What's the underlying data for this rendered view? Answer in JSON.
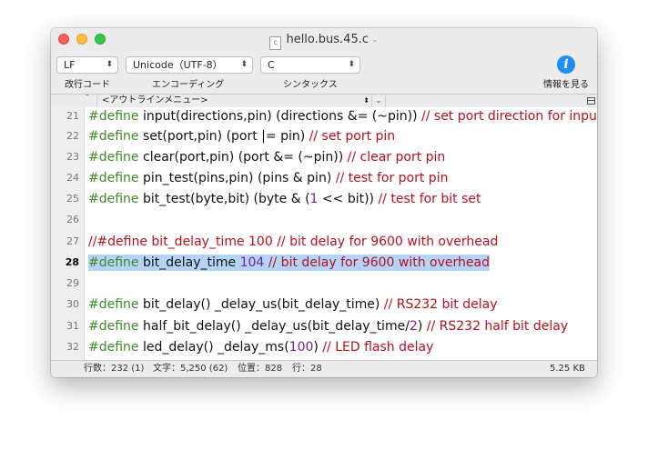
{
  "window": {
    "title": "hello.bus.45.c",
    "file_icon_letter": "c"
  },
  "toolbar": {
    "line_ending": {
      "value": "LF",
      "label": "改行コード"
    },
    "encoding": {
      "value": "Unicode（UTF-8）",
      "label": "エンコーディング"
    },
    "syntax": {
      "value": "C",
      "label": "シンタックス"
    },
    "info_label": "情報を見る"
  },
  "navbar": {
    "outline_menu": "<アウトラインメニュー>"
  },
  "editor": {
    "current_line": "28",
    "lines": [
      {
        "num": "21",
        "kw": "#define",
        "rest": " input(directions,pin) (directions &= (~pin)) ",
        "comment": "// set port direction for input"
      },
      {
        "num": "22",
        "kw": "#define",
        "rest": " set(port,pin) (port |= pin) ",
        "comment": "// set port pin"
      },
      {
        "num": "23",
        "kw": "#define",
        "rest": " clear(port,pin) (port &= (~pin)) ",
        "comment": "// clear port pin"
      },
      {
        "num": "24",
        "kw": "#define",
        "rest": " pin_test(pins,pin) (pins & pin) ",
        "comment": "// test for port pin"
      },
      {
        "num": "25",
        "kw": "#define",
        "rest_a": " bit_test(byte,bit) (byte & (",
        "n": "1",
        "rest_b": " << bit)) ",
        "comment": "// test for bit set"
      },
      {
        "num": "26"
      },
      {
        "num": "27",
        "comment": "//#define bit_delay_time 100 // bit delay for 9600 with overhead"
      },
      {
        "num": "28",
        "kw": "#define",
        "rest": " bit_delay_time ",
        "n": "104",
        "comment": " // bit delay for 9600 with overhead"
      },
      {
        "num": "29"
      },
      {
        "num": "30",
        "kw": "#define",
        "rest": " bit_delay() _delay_us(bit_delay_time) ",
        "comment": "// RS232 bit delay"
      },
      {
        "num": "31",
        "kw": "#define",
        "rest_a": " half_bit_delay() _delay_us(bit_delay_time/",
        "n": "2",
        "rest_b": ") ",
        "comment": "// RS232 half bit delay"
      },
      {
        "num": "32",
        "kw": "#define",
        "rest_a": " led_delay() _delay_ms(",
        "n": "100",
        "rest_b": ") ",
        "comment": "// LED flash delay"
      }
    ]
  },
  "status": {
    "lines": "行数：232 (1)",
    "chars": "文字：5,250 (62)",
    "position": "位置：828",
    "row": "行：28",
    "size": "5.25 KB"
  },
  "icons": [
    "close-button",
    "minimize-button",
    "zoom-button",
    "c-file-icon",
    "info-icon",
    "split-view-icon"
  ],
  "colors": {
    "keyword": "#3f8b2a",
    "comment": "#b8101f",
    "number": "#7a1fa0",
    "selection": "#b3d3f7",
    "info": "#1e8ef3"
  }
}
